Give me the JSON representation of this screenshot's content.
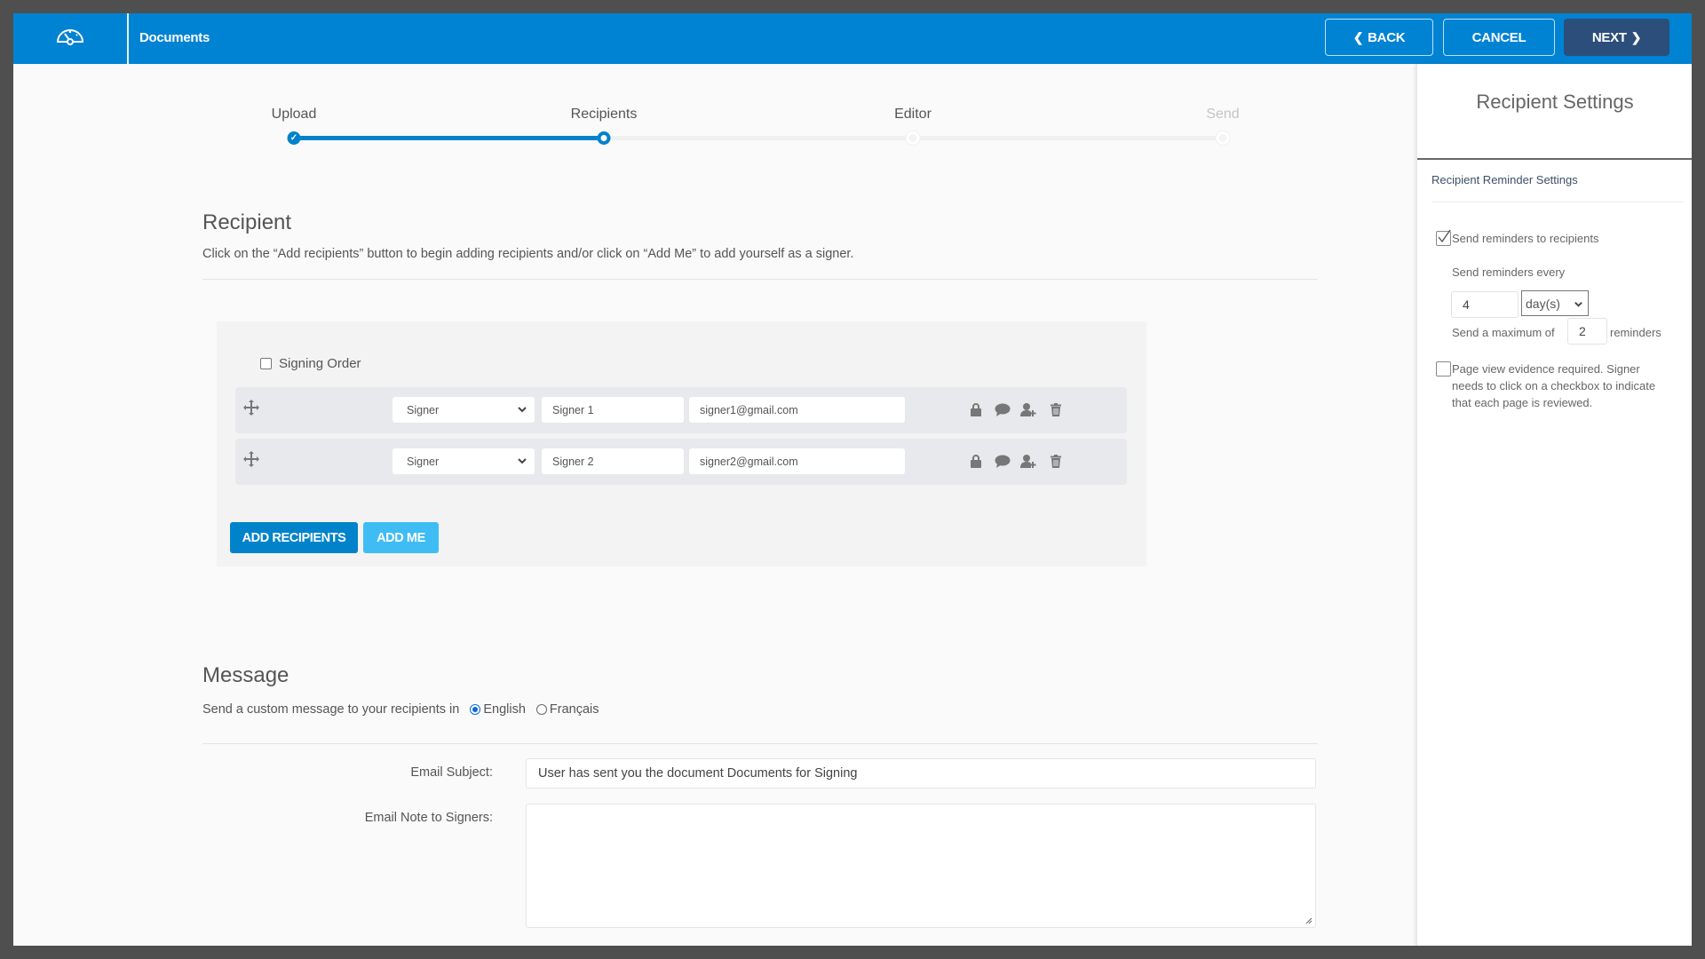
{
  "header": {
    "title": "Documents",
    "logo_icon": "dashboard-gauge-icon",
    "back_label": "BACK",
    "cancel_label": "CANCEL",
    "next_label": "NEXT",
    "colors": {
      "bar": "#0083d3",
      "next_button": "#2c4e7a"
    }
  },
  "stepper": {
    "steps": [
      {
        "label": "Upload",
        "state": "done"
      },
      {
        "label": "Recipients",
        "state": "current"
      },
      {
        "label": "Editor",
        "state": "todo"
      },
      {
        "label": "Send",
        "state": "disabled"
      }
    ]
  },
  "recipient": {
    "title": "Recipient",
    "description": "Click on the “Add recipients” button to begin adding recipients and/or click on “Add Me” to add yourself as a signer.",
    "signing_order_label": "Signing Order",
    "signing_order_checked": false,
    "rows": [
      {
        "role": "Signer",
        "name": "Signer 1",
        "email": "signer1@gmail.com"
      },
      {
        "role": "Signer",
        "name": "Signer 2",
        "email": "signer2@gmail.com"
      }
    ],
    "row_icons": [
      "lock-icon",
      "comment-icon",
      "add-user-icon",
      "trash-icon"
    ],
    "add_recipients_label": "ADD RECIPIENTS",
    "add_me_label": "ADD ME"
  },
  "message": {
    "title": "Message",
    "language_prompt": "Send a custom message to your recipients in",
    "languages": [
      {
        "label": "English",
        "selected": true
      },
      {
        "label": "Français",
        "selected": false
      }
    ],
    "subject_label": "Email Subject:",
    "subject_value": "User has sent you the document Documents for Signing",
    "note_label": "Email Note to Signers:",
    "note_value": ""
  },
  "settings_panel": {
    "title": "Recipient Settings",
    "section_title": "Recipient Reminder Settings",
    "send_reminders_label": "Send reminders to recipients",
    "send_reminders_checked": true,
    "every_label": "Send reminders every",
    "every_value": "4",
    "every_unit": "day(s)",
    "max_prefix": "Send a maximum of",
    "max_value": "2",
    "max_suffix": "reminders",
    "page_view_label": "Page view evidence required. Signer needs to click on a checkbox to indicate that each page is reviewed.",
    "page_view_checked": false
  }
}
